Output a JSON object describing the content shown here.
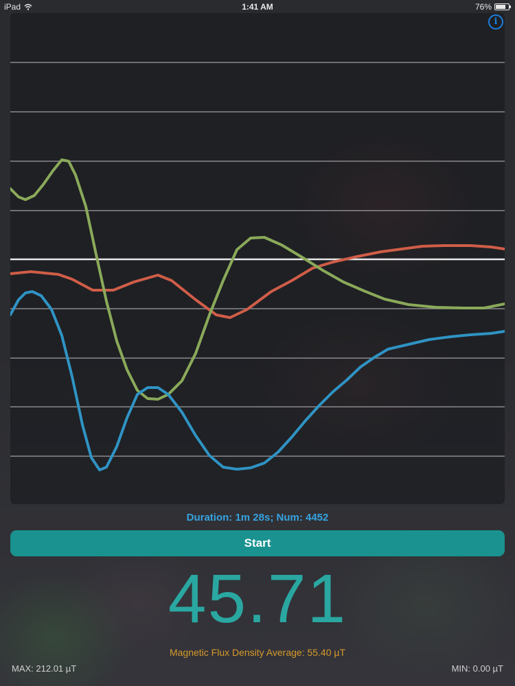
{
  "status_bar": {
    "device": "iPad",
    "time": "1:41 AM",
    "battery": "76%",
    "battery_level": 0.76
  },
  "graph": {
    "info_label": "i",
    "colors": {
      "red": "#cf5d48",
      "green": "#8aaa5a",
      "blue": "#2f93c3",
      "grid": "#8a8a8f",
      "center": "#e8e8e8"
    }
  },
  "duration_text": "Duration: 1m 28s; Num: 4452",
  "start_label": "Start",
  "value": "45.71",
  "average_text": "Magnetic Flux Density Average: 55.40 µT",
  "max_text": "MAX: 212.01 µT",
  "min_text": "MIN: 0.00 µT"
}
